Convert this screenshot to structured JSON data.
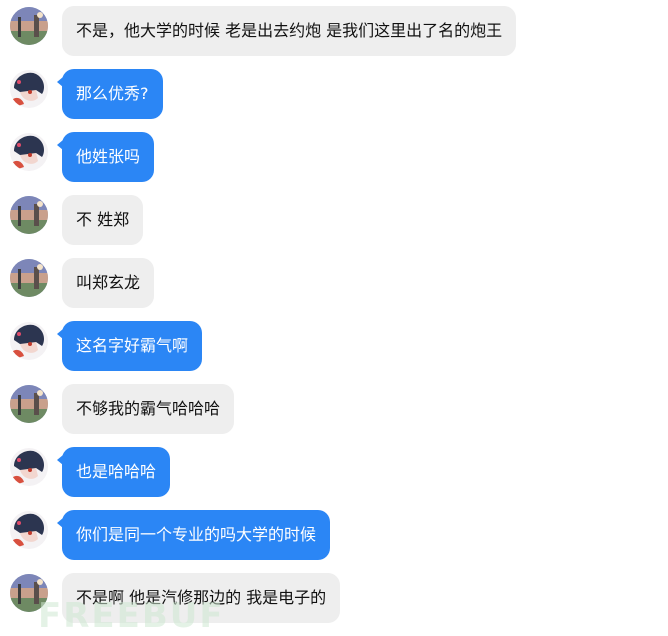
{
  "messages": [
    {
      "side": "incoming",
      "text": "不是，他大学的时候 老是出去约炮  是我们这里出了名的炮王"
    },
    {
      "side": "outgoing",
      "text": "那么优秀?"
    },
    {
      "side": "outgoing",
      "text": "他姓张吗"
    },
    {
      "side": "incoming",
      "text": "不 姓郑"
    },
    {
      "side": "incoming",
      "text": "叫郑玄龙"
    },
    {
      "side": "outgoing",
      "text": "这名字好霸气啊"
    },
    {
      "side": "incoming",
      "text": "不够我的霸气哈哈哈"
    },
    {
      "side": "outgoing",
      "text": "也是哈哈哈"
    },
    {
      "side": "outgoing",
      "text": "你们是同一个专业的吗大学的时候"
    },
    {
      "side": "incoming",
      "text": "不是啊  他是汽修那边的 我是电子的"
    }
  ],
  "avatars": {
    "incoming": "landscape-avatar",
    "outgoing": "anime-girl-avatar"
  },
  "colors": {
    "incoming_bubble": "#eeeeee",
    "outgoing_bubble": "#2b86f5"
  },
  "watermark": "FREEBUF"
}
